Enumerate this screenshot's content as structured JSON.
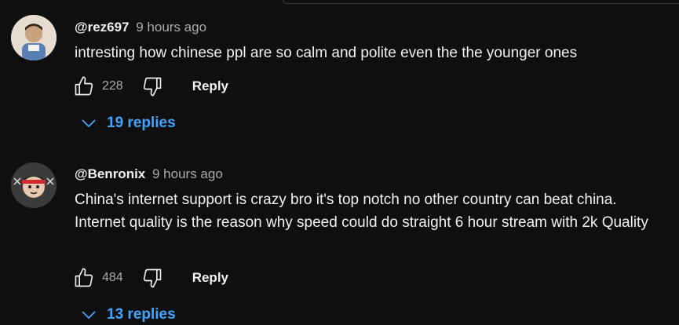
{
  "comments": [
    {
      "author": "@rez697",
      "time": "9 hours ago",
      "text": "intresting how chinese ppl are so calm and polite even the the younger ones",
      "likes": "228",
      "reply_label": "Reply",
      "replies_label": "19 replies"
    },
    {
      "author": "@Benronix",
      "time": "9 hours ago",
      "text": "China's internet support is crazy bro it's top notch no other country can beat china. Internet quality is the reason why speed could do straight 6 hour stream with 2k Quality",
      "likes": "484",
      "reply_label": "Reply",
      "replies_label": "13 replies"
    }
  ],
  "colors": {
    "background": "#0f0f0f",
    "link": "#3ea6ff",
    "secondary_text": "#aaaaaa"
  }
}
